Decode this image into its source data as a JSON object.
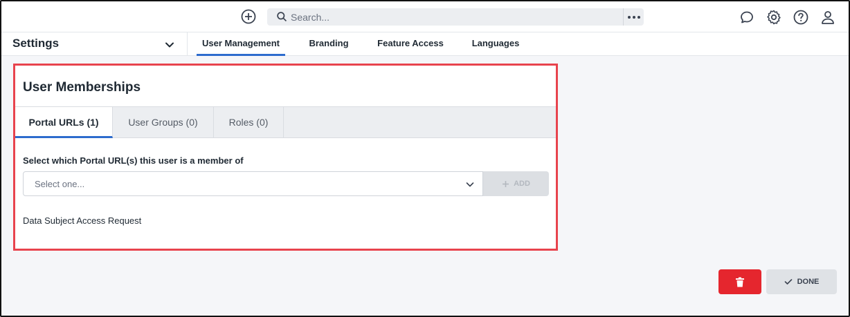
{
  "topbar": {
    "search_placeholder": "Search...",
    "icons": [
      "add-icon",
      "search-icon",
      "more-icon",
      "chat-icon",
      "gear-icon",
      "help-icon",
      "user-icon"
    ]
  },
  "navbar": {
    "title": "Settings",
    "tabs": [
      {
        "label": "User Management",
        "active": true
      },
      {
        "label": "Branding",
        "active": false
      },
      {
        "label": "Feature Access",
        "active": false
      },
      {
        "label": "Languages",
        "active": false
      }
    ]
  },
  "card": {
    "title": "User Memberships",
    "tabs": [
      {
        "label": "Portal URLs (1)",
        "active": true
      },
      {
        "label": "User Groups (0)",
        "active": false
      },
      {
        "label": "Roles (0)",
        "active": false
      }
    ],
    "prompt": "Select which Portal URL(s) this user is a member of",
    "select_placeholder": "Select one...",
    "add_label": "ADD",
    "members": [
      "Data Subject Access Request"
    ]
  },
  "footer": {
    "done_label": "DONE"
  },
  "colors": {
    "accent": "#2d6bcd",
    "highlight": "#e8434d",
    "danger": "#e5262e"
  }
}
